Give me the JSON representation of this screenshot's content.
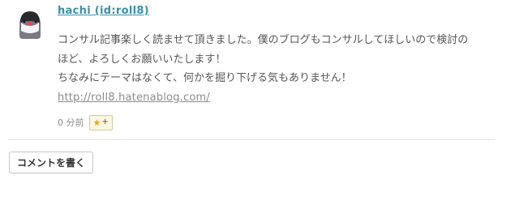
{
  "comment": {
    "author": "hachi (id:roll8)",
    "lines": [
      "コンサル記事楽しく読ませて頂きました。僕のブログもコンサルしてほしいので検討の",
      "ほど、よろしくお願いいたします！",
      "ちなみにテーマはなくて、何かを掘り下げる気もありません！"
    ],
    "link": "http://roll8.hatenablog.com/",
    "timestamp": "0 分前",
    "star_symbol": "★",
    "star_plus": "+",
    "avatar_icon": "java-sparrow-avatar-icon"
  },
  "actions": {
    "write_comment_label": "コメントを書く"
  },
  "colors": {
    "author_link": "#3b8fa8",
    "star": "#e8a716"
  }
}
